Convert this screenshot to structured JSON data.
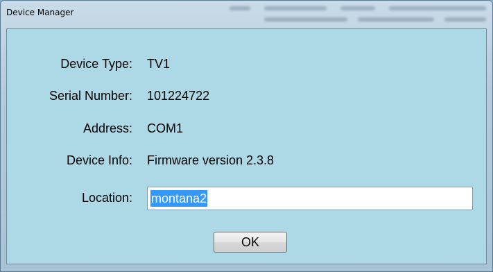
{
  "window": {
    "title": "Device Manager"
  },
  "fields": [
    {
      "label": "Device Type:",
      "value": "TV1"
    },
    {
      "label": "Serial Number:",
      "value": "101224722"
    },
    {
      "label": "Address:",
      "value": "COM1"
    },
    {
      "label": "Device Info:",
      "value": "Firmware version 2.3.8"
    }
  ],
  "location": {
    "label": "Location:",
    "value": "montana2"
  },
  "buttons": {
    "ok_label": "OK"
  },
  "colors": {
    "client_background": "#add8e6",
    "selection": "#3399ff"
  }
}
